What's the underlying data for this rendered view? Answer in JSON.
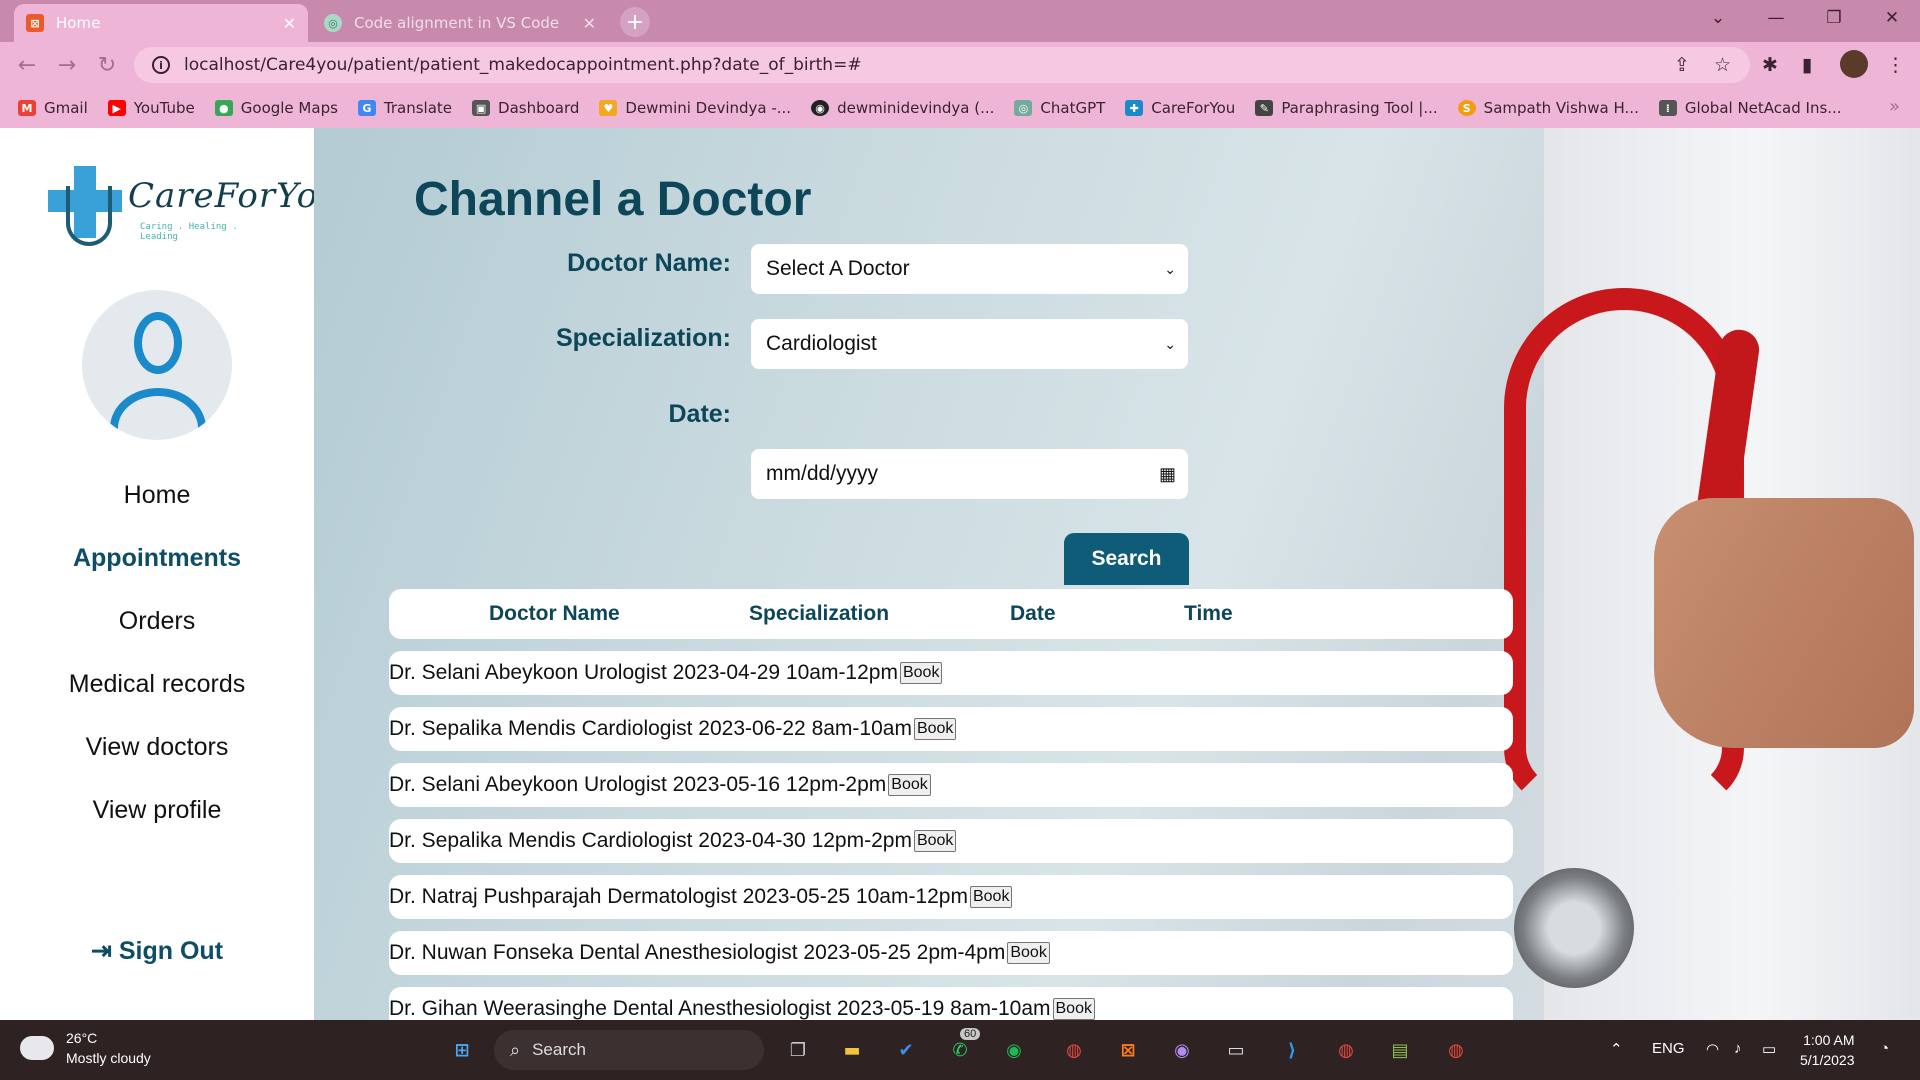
{
  "browser": {
    "tabs": [
      {
        "label": "Home",
        "icon": "xampp-icon",
        "active": true
      },
      {
        "label": "Code alignment in VS Code",
        "icon": "chatgpt-icon",
        "active": false
      }
    ],
    "url": "localhost/Care4you/patient/patient_makedocappointment.php?date_of_birth=#",
    "bookmarks": [
      {
        "label": "Gmail",
        "color": "#ea4335"
      },
      {
        "label": "YouTube",
        "color": "#ff0000"
      },
      {
        "label": "Google Maps",
        "color": "#34a853"
      },
      {
        "label": "Translate",
        "color": "#4285f4"
      },
      {
        "label": "Dashboard",
        "color": "#555555"
      },
      {
        "label": "Dewmini Devindya -...",
        "color": "#f5a623"
      },
      {
        "label": "dewminidevindya (...",
        "color": "#222222"
      },
      {
        "label": "ChatGPT",
        "color": "#74aa9c"
      },
      {
        "label": "CareForYou",
        "color": "#1a8acb"
      },
      {
        "label": "Paraphrasing Tool |...",
        "color": "#444444"
      },
      {
        "label": "Sampath Vishwa H...",
        "color": "#f39c12"
      },
      {
        "label": "Global NetAcad Ins...",
        "color": "#555555"
      }
    ],
    "bookmarks_more": "»"
  },
  "sidebar": {
    "brand": "CareForYou",
    "tagline": "Caring . Healing . Leading",
    "nav": [
      {
        "label": "Home",
        "active": false
      },
      {
        "label": "Appointments",
        "active": true
      },
      {
        "label": "Orders",
        "active": false
      },
      {
        "label": "Medical records",
        "active": false
      },
      {
        "label": "View doctors",
        "active": false
      },
      {
        "label": "View profile",
        "active": false
      }
    ],
    "signout": "Sign Out"
  },
  "main": {
    "title": "Channel a Doctor",
    "form": {
      "doctor_label": "Doctor Name:",
      "doctor_value": "Select A Doctor",
      "spec_label": "Specialization:",
      "spec_value": "Cardiologist",
      "date_label": "Date:",
      "date_placeholder": "mm/dd/yyyy",
      "search_label": "Search"
    },
    "table": {
      "headers": [
        "Doctor Name",
        "Specialization",
        "Date",
        "Time"
      ],
      "book_label": "Book",
      "rows": [
        {
          "text": "Dr. Selani Abeykoon Urologist 2023-04-29 10am-12pm"
        },
        {
          "text": "Dr. Sepalika Mendis Cardiologist 2023-06-22 8am-10am"
        },
        {
          "text": "Dr. Selani Abeykoon Urologist 2023-05-16 12pm-2pm"
        },
        {
          "text": "Dr. Sepalika Mendis Cardiologist 2023-04-30 12pm-2pm"
        },
        {
          "text": "Dr. Natraj Pushparajah Dermatologist 2023-05-25 10am-12pm"
        },
        {
          "text": "Dr. Nuwan Fonseka Dental Anesthesiologist 2023-05-25 2pm-4pm"
        },
        {
          "text": "Dr. Gihan Weerasinghe Dental Anesthesiologist 2023-05-19 8am-10am"
        }
      ]
    },
    "colors": {
      "accent": "#0d4659",
      "button": "#0e5c78"
    }
  },
  "taskbar": {
    "weather_temp": "26°C",
    "weather_desc": "Mostly cloudy",
    "search_label": "Search",
    "whatsapp_badge": "60",
    "lang": "ENG",
    "time": "1:00 AM",
    "date": "5/1/2023"
  }
}
